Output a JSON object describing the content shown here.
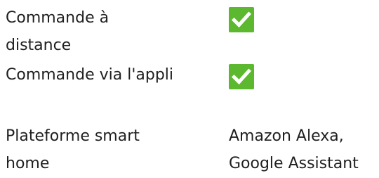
{
  "features": [
    {
      "label": "Commande à distance",
      "value_type": "check",
      "supported": true
    },
    {
      "label": "Commande via l'appli",
      "value_type": "check",
      "supported": true
    },
    {
      "label": "Plateforme smart home",
      "value_type": "text",
      "value": "Amazon Alexa, Google Assistant"
    }
  ],
  "colors": {
    "check_background": "#5cb82e",
    "check_mark": "#ffffff",
    "text": "#1f1f1f"
  },
  "icons": {
    "check": "checkmark-square-icon"
  }
}
